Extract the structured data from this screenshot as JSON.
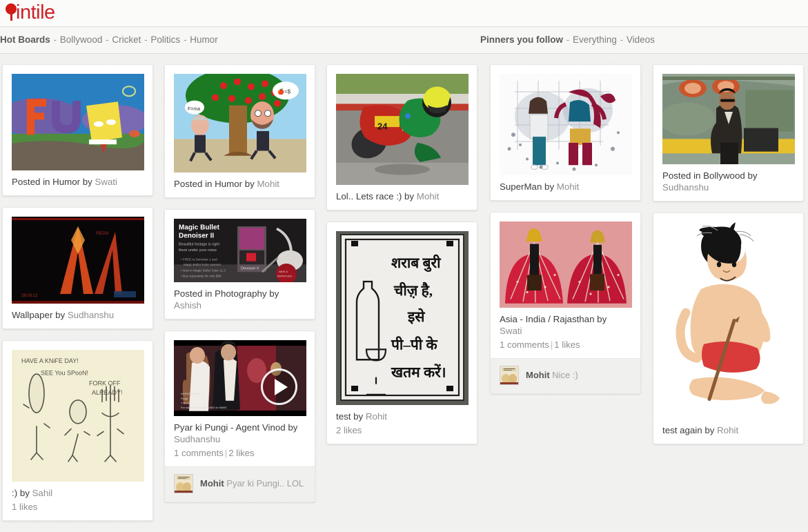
{
  "brand": {
    "logo_text": "intile",
    "logo_icon": "pin-icon",
    "logo_color": "#cc2127"
  },
  "nav": {
    "left": {
      "title": "Hot Boards",
      "links": [
        "Bollywood",
        "Cricket",
        "Politics",
        "Humor"
      ]
    },
    "right": {
      "title": "Pinners you follow",
      "links": [
        "Everything",
        "Videos"
      ]
    },
    "separator": "-"
  },
  "columns": [
    {
      "id": "column-1",
      "cards": [
        {
          "id": "card-fun-spongebob",
          "media": "spongebob-fun-letters",
          "media_height": 140,
          "caption": "Posted in Humor by ",
          "byline": "Swati"
        },
        {
          "id": "card-wallpaper-agent-vinod",
          "media": "agent-vinod-wallpaper",
          "media_height": 126,
          "caption": "Wallpaper by ",
          "byline": "Sudhanshu"
        },
        {
          "id": "card-knife-day-cartoon",
          "media": "cutlery-cartoon",
          "media_height": 191,
          "caption": ":) by ",
          "byline": "Sahil",
          "meta": "1 likes"
        }
      ]
    },
    {
      "id": "column-2",
      "cards": [
        {
          "id": "card-newton-jobs-apple",
          "media": "newton-jobs-apple-tree",
          "media_height": 143,
          "caption": "Posted in Humor by ",
          "byline": "Mohit"
        },
        {
          "id": "card-magic-bullet-denoiser",
          "media": "magic-bullet-denoiser-ad",
          "media_height": 92,
          "caption": "Posted in Photography by ",
          "byline": "Ashish"
        },
        {
          "id": "card-pyar-ki-pungi-video",
          "media": "pyar-ki-pungi-video",
          "media_height": 110,
          "is_video": true,
          "caption": "Pyar ki Pungi - Agent Vinod by ",
          "byline": "Sudhanshu",
          "meta_comments": "1 comments",
          "meta_likes": "2 likes",
          "comment": {
            "author": "Mohit",
            "text": "Pyar ki Pungi.. LOL :P",
            "avatar": "mohit-avatar"
          }
        }
      ]
    },
    {
      "id": "column-3",
      "cards": [
        {
          "id": "card-motorbike-race",
          "media": "motorbike-racer",
          "media_height": 161,
          "caption": "Lol.. Lets race :) by ",
          "byline": "Mohit"
        },
        {
          "id": "card-sharab-buri-cheez",
          "media": "hindi-liquor-sign",
          "media_height": 252,
          "caption": "test by ",
          "byline": "Rohit",
          "meta": "2 likes"
        }
      ]
    },
    {
      "id": "column-4",
      "cards": [
        {
          "id": "card-superman",
          "media": "superman-illustration",
          "media_height": 147,
          "caption": "SuperMan by ",
          "byline": "Mohit"
        },
        {
          "id": "card-asia-india-rajasthan",
          "media": "rajasthan-puppets",
          "media_height": 125,
          "caption": "Asia - India / Rajasthan by ",
          "byline": "Swati",
          "meta_comments": "1 comments",
          "meta_likes": "1 likes",
          "comment": {
            "author": "Mohit",
            "text": "Nice :)",
            "avatar": "mohit-avatar"
          }
        }
      ]
    },
    {
      "id": "column-5",
      "cards": [
        {
          "id": "card-bollywood-helicopter",
          "media": "actor-helicopter",
          "media_height": 131,
          "caption": "Posted in Bollywood by ",
          "byline": "Sudhanshu"
        },
        {
          "id": "card-mowgli",
          "media": "mowgli-cartoon",
          "media_height": 285,
          "caption": "test again by ",
          "byline": "Rohit"
        }
      ]
    }
  ]
}
